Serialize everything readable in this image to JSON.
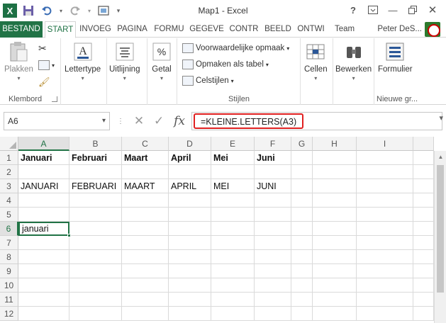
{
  "window": {
    "title": "Map1 - Excel"
  },
  "qat": {
    "logo": "X"
  },
  "tabs": [
    {
      "label": "BESTAND"
    },
    {
      "label": "START"
    },
    {
      "label": "INVOEG"
    },
    {
      "label": "PAGINA"
    },
    {
      "label": "FORMU"
    },
    {
      "label": "GEGEVE"
    },
    {
      "label": "CONTR"
    },
    {
      "label": "BEELD"
    },
    {
      "label": "ONTWI"
    },
    {
      "label": "Team"
    }
  ],
  "user": {
    "name": "Peter DeS..."
  },
  "ribbon": {
    "paste_label": "Plakken",
    "clipboard_label": "Klembord",
    "font_label": "Lettertype",
    "alignment_label": "Uitlijning",
    "number_label": "Getal",
    "cond_format_label": "Voorwaardelijke opmaak",
    "format_table_label": "Opmaken als tabel",
    "cell_styles_label": "Celstijlen",
    "styles_group_label": "Stijlen",
    "cells_label": "Cellen",
    "editing_label": "Bewerken",
    "formulier_label": "Formulier",
    "new_group_label": "Nieuwe gr..."
  },
  "formula_bar": {
    "name_box": "A6",
    "fx": "fx",
    "formula": "=KLEINE.LETTERS(A3)"
  },
  "grid": {
    "columns": [
      "A",
      "B",
      "C",
      "D",
      "E",
      "F",
      "G",
      "H",
      "I"
    ],
    "rows": [
      "1",
      "2",
      "3",
      "4",
      "5",
      "6",
      "7",
      "8",
      "9",
      "10",
      "11",
      "12"
    ],
    "row1": [
      "Januari",
      "Februari",
      "Maart",
      "April",
      "Mei",
      "Juni"
    ],
    "row3": [
      "JANUARI",
      "FEBRUARI",
      "MAART",
      "APRIL",
      "MEI",
      "JUNI"
    ],
    "a6": "januari"
  },
  "colors": {
    "accent": "#217346",
    "highlight": "#e02020"
  },
  "icons": [
    "excel-logo-icon",
    "save-icon",
    "undo-icon",
    "redo-icon",
    "screenshot-icon",
    "help-icon",
    "minimize-icon",
    "restore-icon",
    "close-icon"
  ]
}
